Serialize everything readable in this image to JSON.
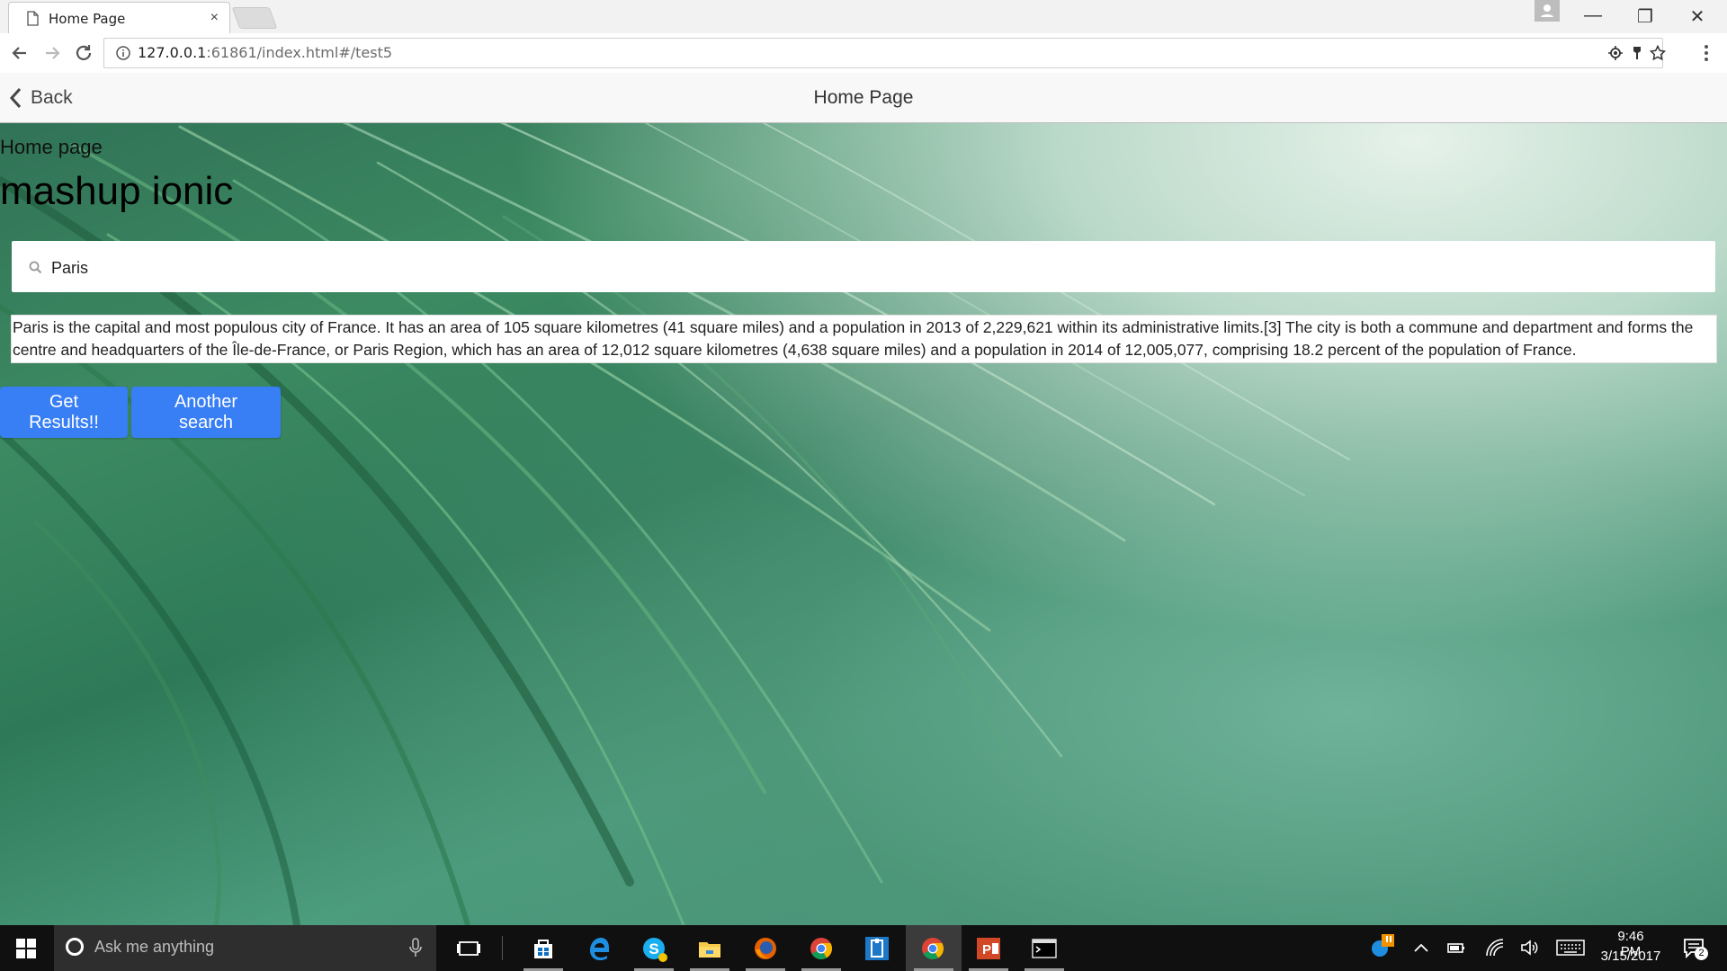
{
  "browser": {
    "tab_title": "Home Page",
    "tab_close": "×",
    "url_host": "127.0.0.1",
    "url_rest": ":61861/index.html#/test5",
    "window_controls": {
      "minimize": "—",
      "restore": "❐",
      "close": "✕"
    }
  },
  "app": {
    "navbar": {
      "back_label": "Back",
      "title": "Home Page"
    },
    "small_heading": "Home page",
    "big_heading": "mashup ionic",
    "search": {
      "value": "Paris",
      "placeholder": ""
    },
    "result": "Paris is the capital and most populous city of France. It has an area of 105 square kilometres (41 square miles) and a population in 2013 of 2,229,621 within its administrative limits.[3] The city is both a commune and department and forms the centre and headquarters of the Île-de-France, or Paris Region, which has an area of 12,012 square kilometres (4,638 square miles) and a population in 2014 of 12,005,077, comprising 18.2 percent of the population of France.",
    "buttons": {
      "get_results": "Get Results!!",
      "another_search": "Another search"
    },
    "accent_color": "#387ef5"
  },
  "taskbar": {
    "search_placeholder": "Ask me anything",
    "apps": [
      "store-icon",
      "edge-icon",
      "skype-icon",
      "file-explorer-icon",
      "firefox-icon",
      "chrome-icon",
      "notepad-app-icon",
      "chrome-active-icon",
      "powerpoint-icon",
      "terminal-icon"
    ],
    "clock_time": "9:46 PM",
    "clock_date": "3/15/2017",
    "notification_count": "2"
  }
}
